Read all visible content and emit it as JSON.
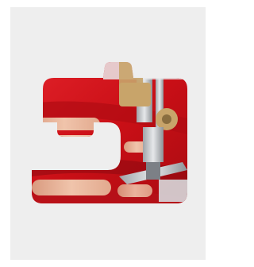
{
  "image": {
    "subject": "sewing-machine-presser-foot-on-red-fabric",
    "silhouette": "sewing-machine-icon",
    "colors": {
      "background": "#eeeeee",
      "fabric": "#d8141c",
      "fabric_shadow": "#8c0a10",
      "metal": "#c9cbcf",
      "brass": "#c8a46a",
      "skin": "#e9b79c"
    }
  }
}
